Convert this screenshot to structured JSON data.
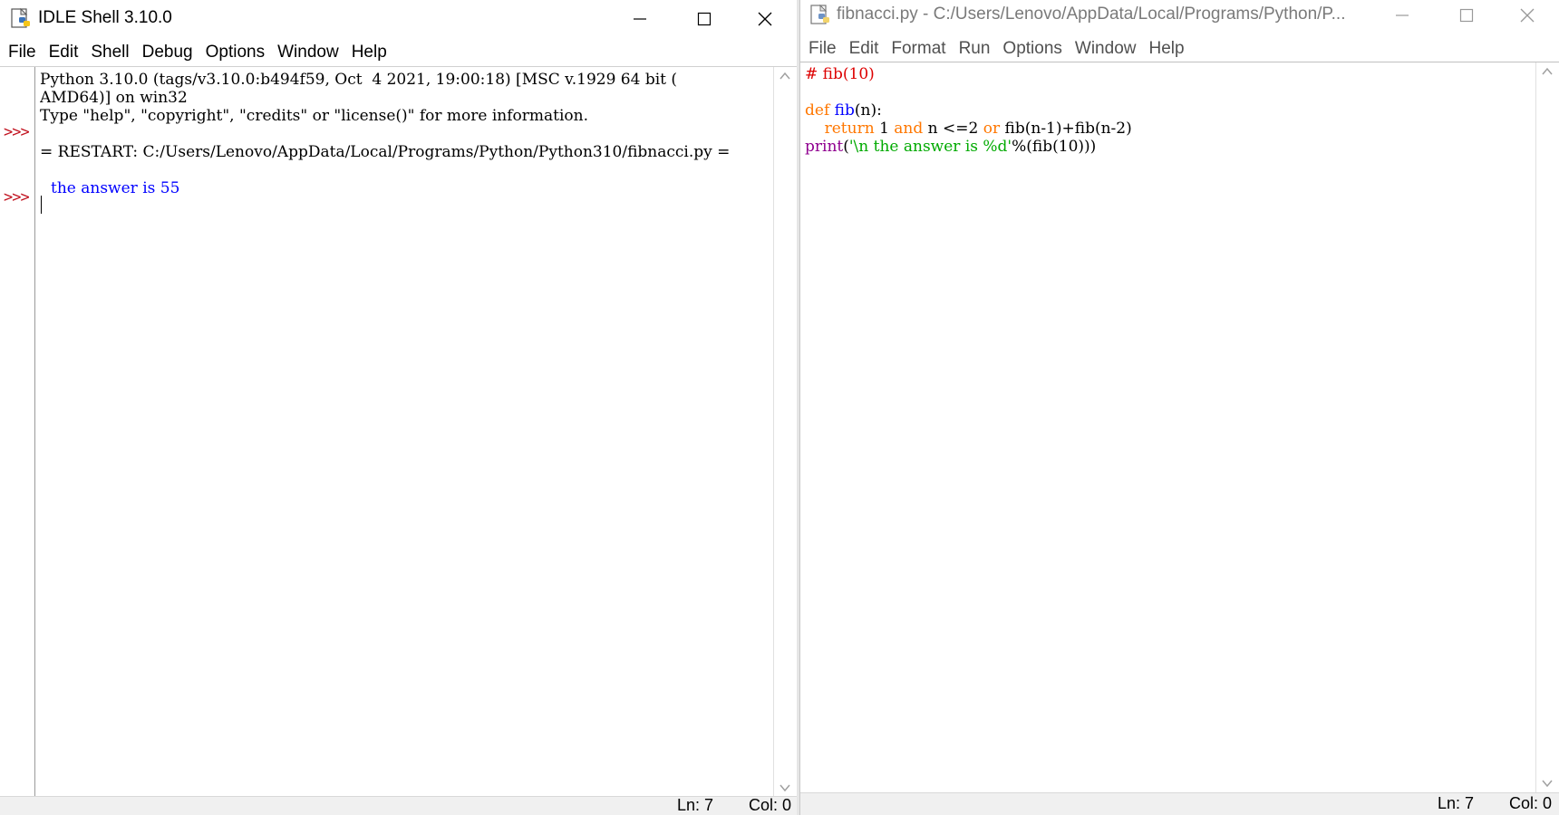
{
  "shell": {
    "title": "IDLE Shell 3.10.0",
    "menu": [
      "File",
      "Edit",
      "Shell",
      "Debug",
      "Options",
      "Window",
      "Help"
    ],
    "prompt": ">>>",
    "lines": {
      "banner1": "Python 3.10.0 (tags/v3.10.0:b494f59, Oct  4 2021, 19:00:18) [MSC v.1929 64 bit (",
      "banner2": "AMD64)] on win32",
      "banner3": "Type \"help\", \"copyright\", \"credits\" or \"license()\" for more information.",
      "restart": "= RESTART: C:/Users/Lenovo/AppData/Local/Programs/Python/Python310/fibnacci.py =",
      "output": "the answer is 55"
    },
    "status": {
      "ln": "Ln: 7",
      "col": "Col: 0"
    }
  },
  "editor": {
    "title": "fibnacci.py - C:/Users/Lenovo/AppData/Local/Programs/Python/P...",
    "menu": [
      "File",
      "Edit",
      "Format",
      "Run",
      "Options",
      "Window",
      "Help"
    ],
    "code": {
      "comment": "# fib(10)",
      "def_kw": "def",
      "def_name": "fib",
      "def_rest": "(n):",
      "indent": "    ",
      "return_kw": "return",
      "ret_1": " 1 ",
      "and_kw": "and",
      "ret_2": " n <=2 ",
      "or_kw": "or",
      "ret_3": " fib(n-1)+fib(n-2)",
      "print_bi": "print",
      "print_open": "(",
      "print_str": "'\\n the answer is %d'",
      "print_rest": "%(fib(10)))"
    },
    "status": {
      "ln": "Ln: 7",
      "col": "Col: 0"
    }
  },
  "icons": {
    "app": "python-idle-icon",
    "minimize": "minimize-icon",
    "maximize": "maximize-icon",
    "close": "close-icon",
    "scroll_up": "chevron-up-icon",
    "scroll_down": "chevron-down-icon"
  },
  "colors": {
    "keyword": "#ff7700",
    "builtin": "#900090",
    "string": "#00aa00",
    "comment": "#dd0000",
    "definition": "#0000ff",
    "stdout": "#0000ff",
    "prompt": "#c1121f"
  }
}
